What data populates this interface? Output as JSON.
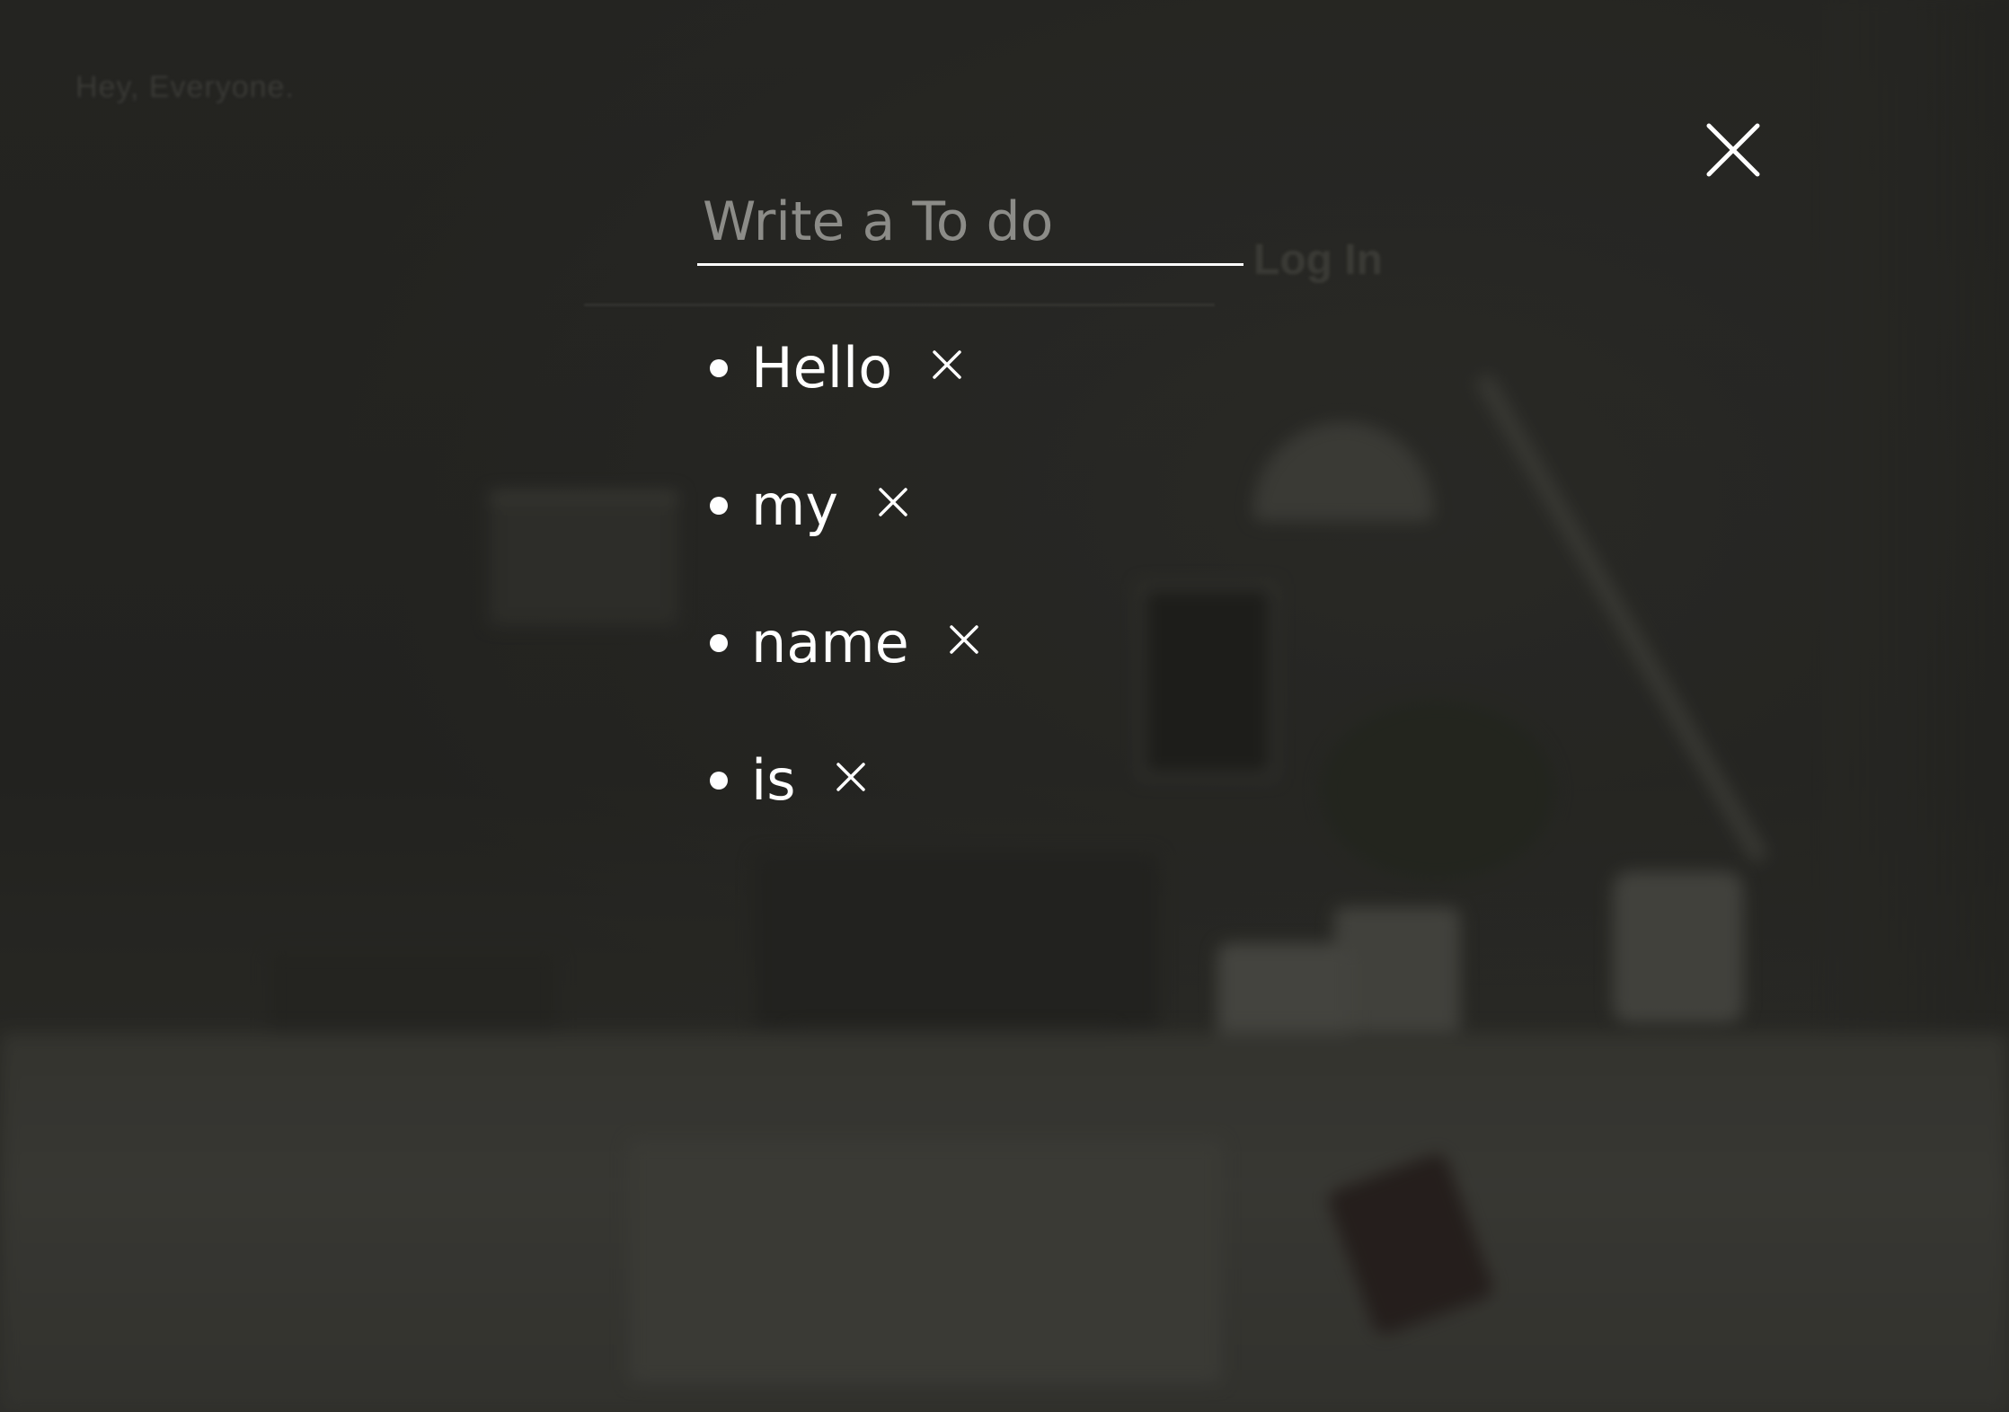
{
  "background": {
    "header_brand": "Hey, Everyone.",
    "login_label": "Log In"
  },
  "todo": {
    "placeholder": "Write a To do",
    "value": "",
    "items": [
      {
        "text": "Hello"
      },
      {
        "text": "my"
      },
      {
        "text": "name"
      },
      {
        "text": "is"
      }
    ]
  },
  "icons": {
    "close": "close-icon",
    "delete": "x-icon"
  },
  "colors": {
    "text": "#ffffff",
    "placeholder": "#8c8c88",
    "overlay": "#1f1f1c"
  }
}
